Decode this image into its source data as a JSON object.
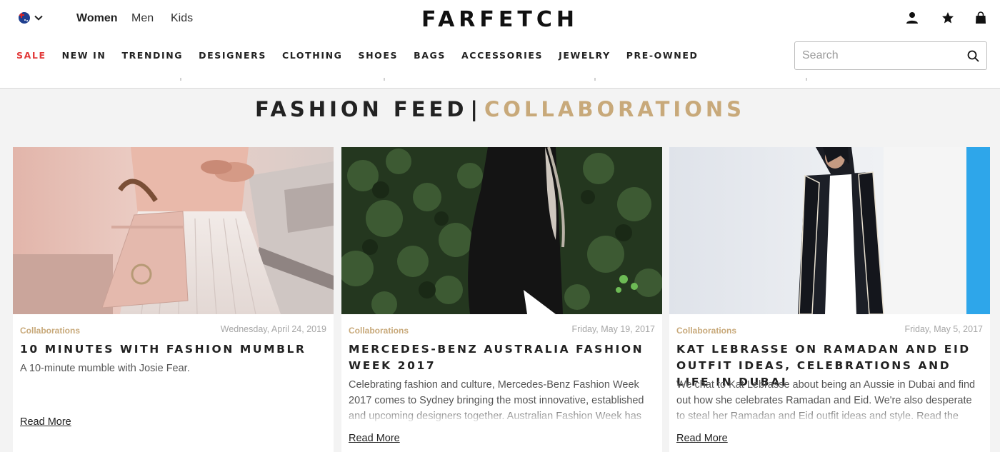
{
  "header": {
    "region_icon": "australia-flag-icon",
    "genders": [
      "Women",
      "Men",
      "Kids"
    ],
    "active_gender": "Women",
    "logo": "FARFETCH",
    "icons": [
      "account-icon",
      "wishlist-star-icon",
      "shopping-bag-icon"
    ],
    "search_placeholder": "Search"
  },
  "nav": {
    "items": [
      "SALE",
      "NEW IN",
      "TRENDING",
      "DESIGNERS",
      "CLOTHING",
      "SHOES",
      "BAGS",
      "ACCESSORIES",
      "JEWELRY",
      "PRE-OWNED"
    ]
  },
  "page": {
    "title": "FASHION FEED",
    "separator": "|",
    "subtitle": "COLLABORATIONS"
  },
  "cards": [
    {
      "category": "Collaborations",
      "date": "Wednesday, April 24, 2019",
      "title": "10 MINUTES WITH FASHION MUMBLR",
      "description": "A 10-minute mumble with Josie Fear.",
      "link": "Read More"
    },
    {
      "category": "Collaborations",
      "date": "Friday, May 19, 2017",
      "title": "MERCEDES-BENZ AUSTRALIA FASHION WEEK 2017",
      "description": "Celebrating fashion and culture, Mercedes-Benz Fashion Week 2017 comes to Sydney bringing the most innovative, established and upcoming designers together. Australian Fashion Week has become",
      "link": "Read More"
    },
    {
      "category": "Collaborations",
      "date": "Friday, May 5, 2017",
      "title": "KAT LEBRASSE ON RAMADAN AND EID OUTFIT IDEAS, CELEBRATIONS AND LIFE IN DUBAI",
      "description": "We chat to Kat Lebrasse about being an Aussie in Dubai and find out how she celebrates Ramadan and Eid. We're also desperate to steal her Ramadan and Eid outfit ideas and style. Read the interview now to",
      "link": "Read More"
    }
  ],
  "colors": {
    "accent_gold": "#c8a97a",
    "sale_red": "#e23a3a",
    "background": "#f3f3f3"
  }
}
